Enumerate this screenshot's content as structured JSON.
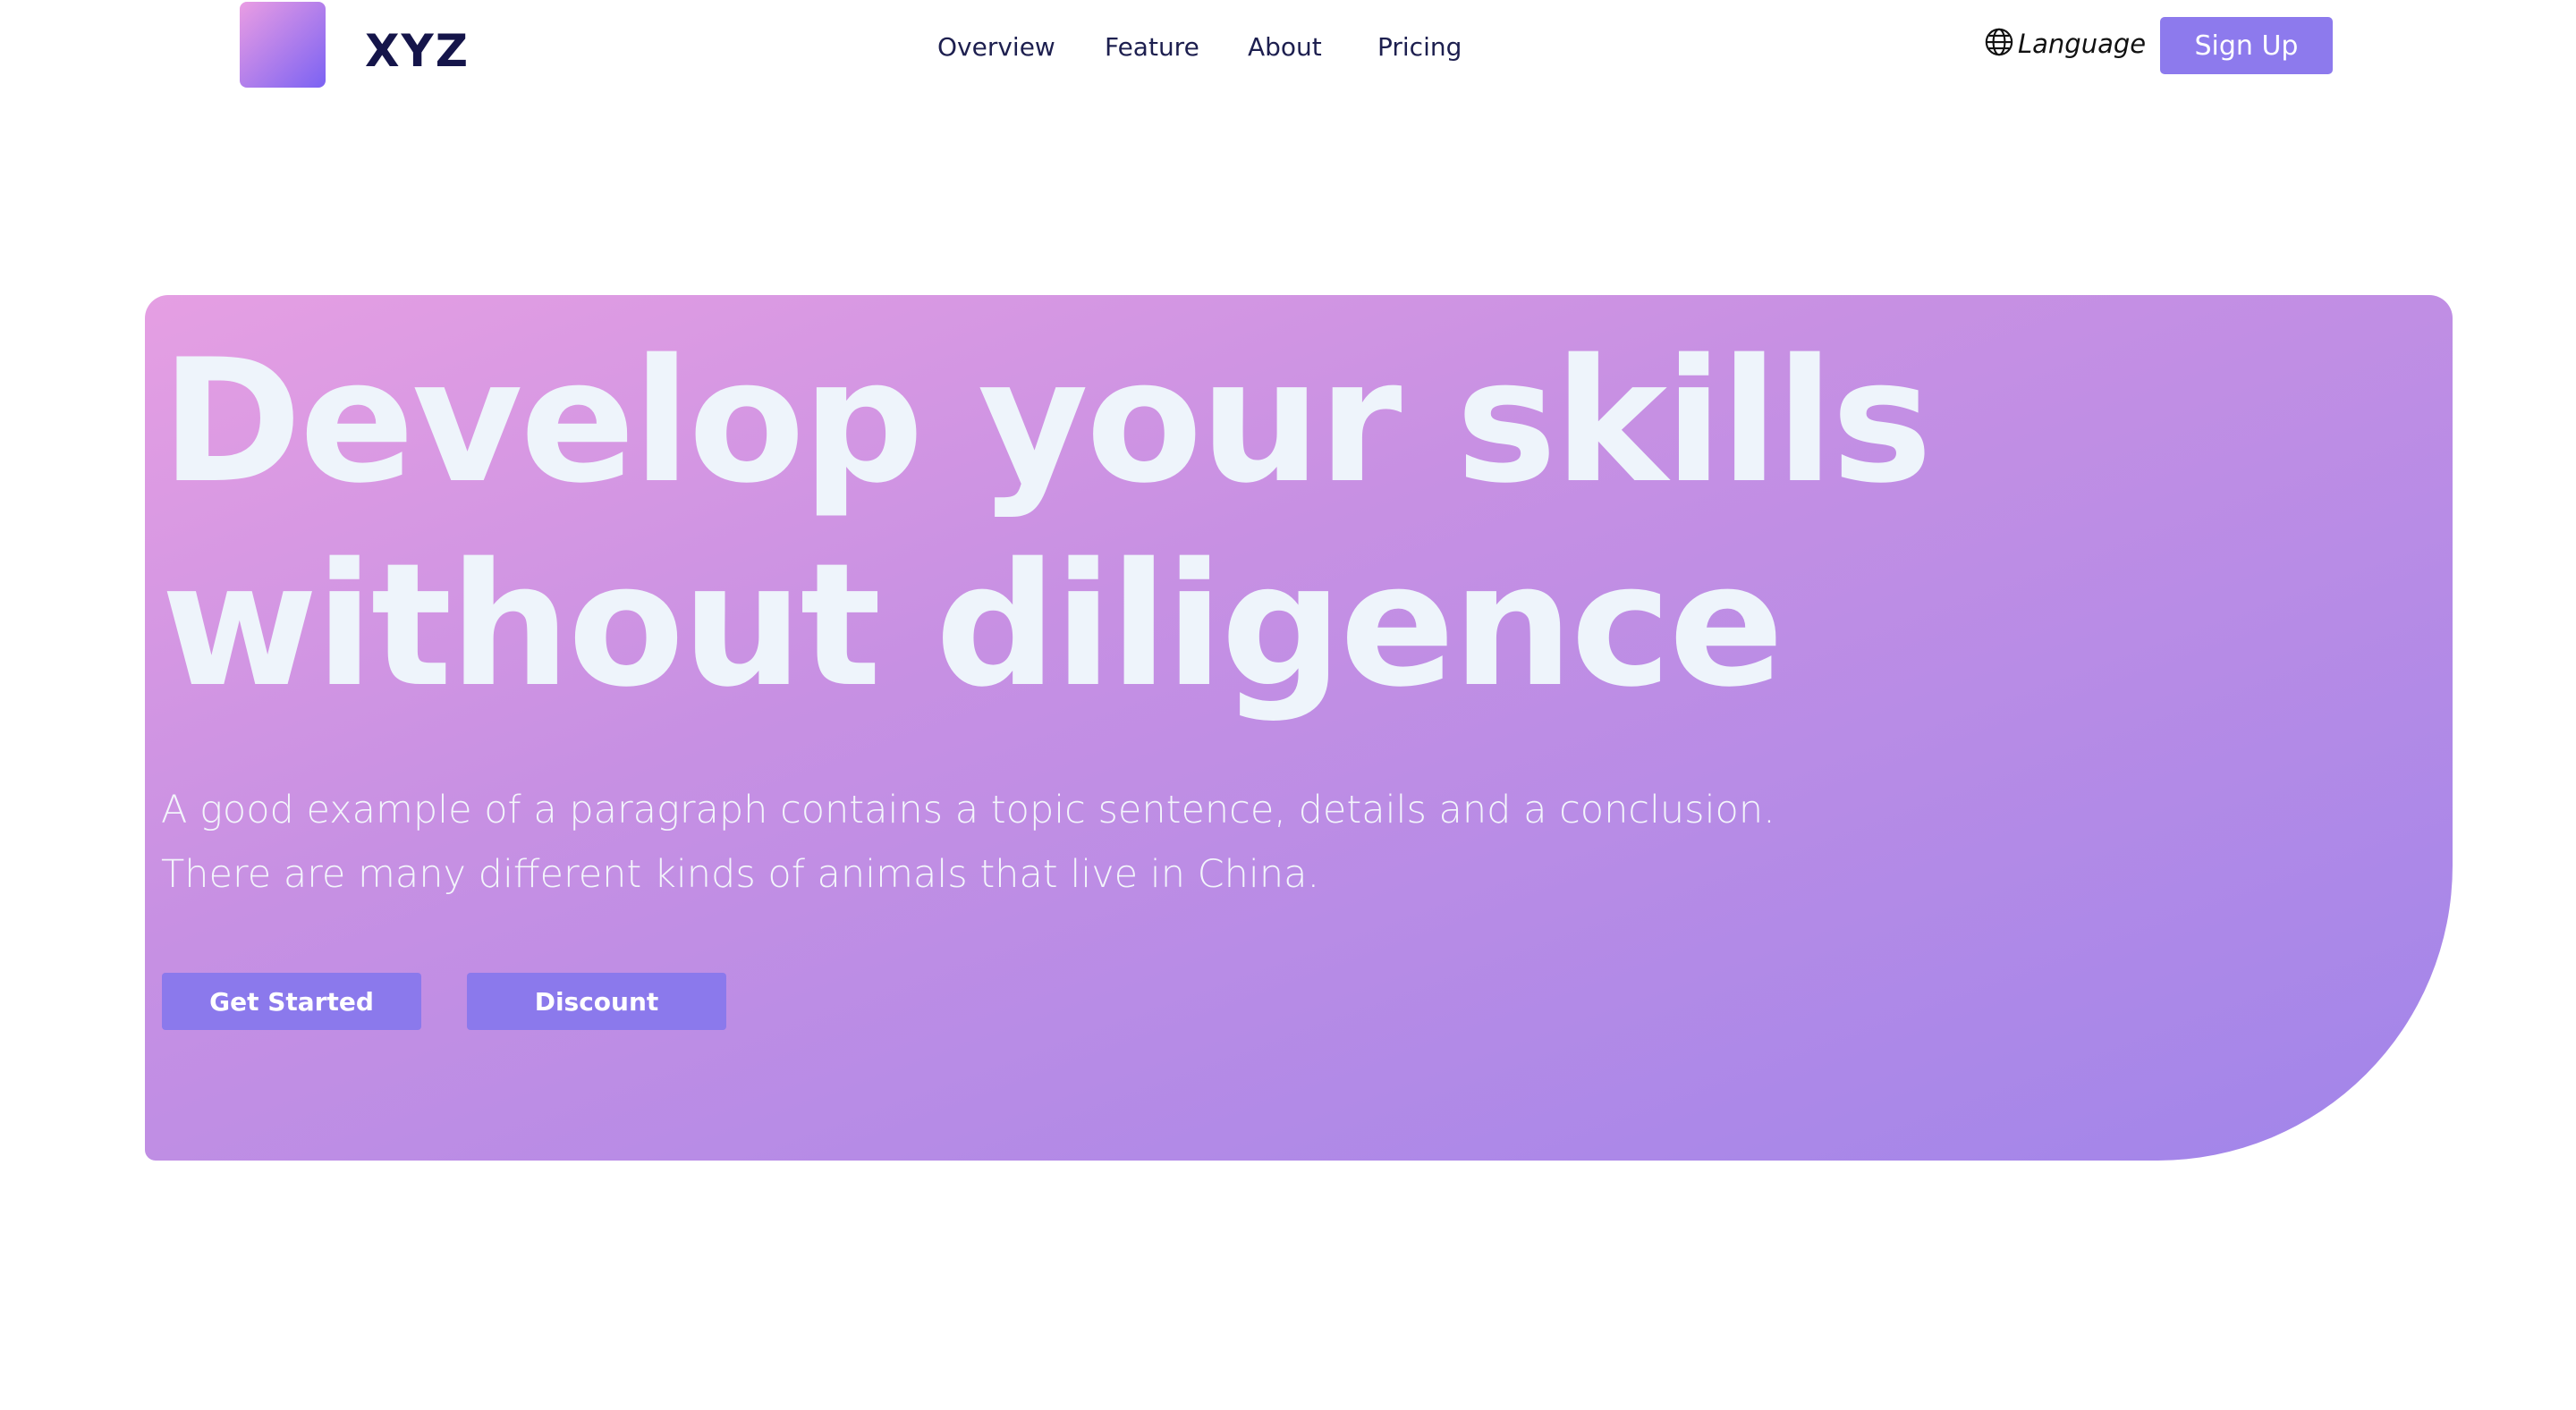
{
  "brand": {
    "name": "XYZ"
  },
  "nav": {
    "items": [
      {
        "label": "Overview"
      },
      {
        "label": "Feature"
      },
      {
        "label": "About"
      },
      {
        "label": "Pricing"
      }
    ]
  },
  "header": {
    "language_label": "Language",
    "language_icon": "globe-icon",
    "signup_label": "Sign Up"
  },
  "hero": {
    "title_line1": "Develop your skills",
    "title_line2": "without diligence",
    "subtitle_line1": "A good example of a paragraph contains a topic sentence, details and a conclusion.",
    "subtitle_line2": "There are many different kinds of animals that live in China.",
    "primary_button": "Get Started",
    "secondary_button": "Discount"
  },
  "colors": {
    "accent": "#8d7aed",
    "hero_gradient_start": "#e59fe3",
    "hero_gradient_end": "#a185ea",
    "brand_text": "#15154a",
    "hero_text": "#eef4fb"
  }
}
